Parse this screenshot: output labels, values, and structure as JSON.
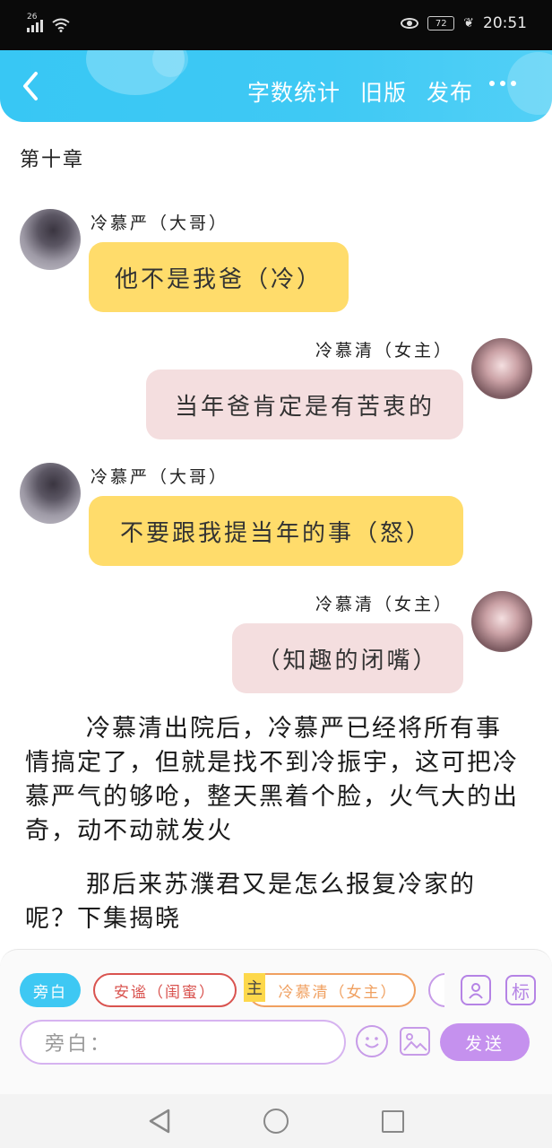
{
  "status_bar": {
    "network": "26",
    "battery": "72",
    "time": "20:51"
  },
  "header": {
    "actions": [
      "字数统计",
      "旧版",
      "发布"
    ]
  },
  "chapter_title": "第十章",
  "messages": [
    {
      "speaker": "冷慕严（大哥）",
      "text": "他不是我爸（冷）",
      "side": "left",
      "color": "#ffdc6b"
    },
    {
      "speaker": "冷慕清（女主）",
      "text": "当年爸肯定是有苦衷的",
      "side": "right",
      "color": "#f4dedf"
    },
    {
      "speaker": "冷慕严（大哥）",
      "text": "不要跟我提当年的事（怒）",
      "side": "left",
      "color": "#ffdc6b"
    },
    {
      "speaker": "冷慕清（女主）",
      "text": "（知趣的闭嘴）",
      "side": "right",
      "color": "#f4dedf"
    }
  ],
  "narration": [
    "冷慕清出院后，冷慕严已经将所有事情搞定了，但就是找不到冷振宇，这可把冷慕严气的够呛，整天黑着个脸，火气大的出奇，动不动就发火",
    "那后来苏濮君又是怎么报复冷家的呢？下集揭晓"
  ],
  "editor": {
    "roles": [
      {
        "label": "旁白",
        "state": "active"
      },
      {
        "label": "安谧（闺蜜）",
        "state": "normal"
      },
      {
        "label": "冷慕清（女主）",
        "state": "normal"
      }
    ],
    "main_tag": "主",
    "tag_button": "标",
    "input_placeholder": "旁白：",
    "send_label": "发送"
  },
  "colors": {
    "header": "#3ec8f3",
    "accent": "#c591ee"
  }
}
